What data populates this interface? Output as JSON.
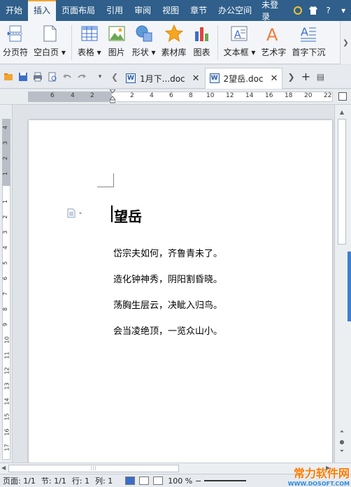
{
  "menubar": {
    "tabs": [
      "开始",
      "插入",
      "页面布局",
      "引用",
      "审阅",
      "视图",
      "章节",
      "办公空间"
    ],
    "active_tab": "插入",
    "login": "未登录"
  },
  "ribbon": {
    "buttons": [
      {
        "label": "分页符",
        "icon": "page-break-icon"
      },
      {
        "label": "空白页 ▾",
        "icon": "blank-page-icon"
      },
      {
        "label": "表格 ▾",
        "icon": "table-icon"
      },
      {
        "label": "图片",
        "icon": "picture-icon"
      },
      {
        "label": "形状 ▾",
        "icon": "shapes-icon"
      },
      {
        "label": "素材库",
        "icon": "star-icon"
      },
      {
        "label": "图表",
        "icon": "chart-icon"
      },
      {
        "label": "文本框 ▾",
        "icon": "textbox-icon"
      },
      {
        "label": "艺术字",
        "icon": "wordart-icon"
      },
      {
        "label": "首字下沉",
        "icon": "dropcap-icon"
      }
    ]
  },
  "doctabs": [
    {
      "label": "1月下...doc",
      "active": false
    },
    {
      "label": "2望岳.doc",
      "active": true
    }
  ],
  "hruler": {
    "numbers": [
      "6",
      "4",
      "2",
      "2",
      "2",
      "4",
      "6",
      "8",
      "10",
      "12",
      "14",
      "16",
      "18",
      "20",
      "22"
    ]
  },
  "vruler": {
    "numbers": [
      "4",
      "3",
      "2",
      "1",
      "1",
      "2",
      "3",
      "4",
      "5",
      "6",
      "7",
      "8",
      "9",
      "10",
      "11",
      "12",
      "13",
      "14",
      "15",
      "16",
      "17",
      "18"
    ]
  },
  "document": {
    "title": "望岳",
    "lines": [
      "岱宗夫如何，齐鲁青未了。",
      "造化钟神秀，阴阳割昏晓。",
      "荡胸生层云，决眦入归鸟。",
      "会当凌绝顶，一览众山小。"
    ]
  },
  "status": {
    "page": "页面: 1/1",
    "section": "节: 1/1",
    "row": "行: 1",
    "col": "列: 1",
    "zoom": "100 %"
  },
  "watermark": {
    "line1": "常力软件网",
    "line2": "WWW.DOSOFT.COM"
  },
  "colors": {
    "menubar": "#2f5f8a",
    "accent": "#f2a533",
    "scroll_tab": "#3d7fd0"
  }
}
